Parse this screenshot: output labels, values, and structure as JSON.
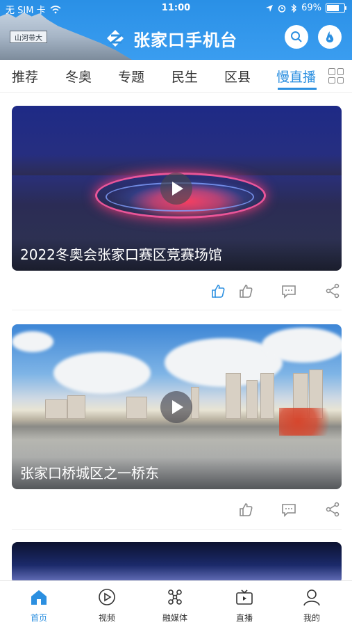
{
  "status_bar": {
    "carrier": "无 SIM 卡",
    "time": "11:00",
    "battery": "69%"
  },
  "header": {
    "app_title": "张家口手机台",
    "plaque_text": "山河带大",
    "icons": {
      "search": "search-icon",
      "profile": "live-broadcast-icon"
    },
    "colors": {
      "brand_blue": "#2b8fe0",
      "header_bg": "#3a9df0"
    }
  },
  "tabs": {
    "items": [
      {
        "label": "推荐"
      },
      {
        "label": "冬奥"
      },
      {
        "label": "专题"
      },
      {
        "label": "民生"
      },
      {
        "label": "区县"
      },
      {
        "label": "慢直播"
      }
    ],
    "active_index": 5,
    "grid_icon": "grid-icon"
  },
  "feed": {
    "items": [
      {
        "title": "2022冬奥会张家口赛区竞赛场馆",
        "actions": {
          "like_active": true
        }
      },
      {
        "title": "张家口桥城区之一桥东",
        "actions": {
          "like_active": false
        }
      }
    ]
  },
  "bottom_nav": {
    "items": [
      {
        "label": "首页",
        "icon": "home-icon"
      },
      {
        "label": "视频",
        "icon": "play-circle-icon"
      },
      {
        "label": "融媒体",
        "icon": "media-icon"
      },
      {
        "label": "直播",
        "icon": "tv-icon"
      },
      {
        "label": "我的",
        "icon": "user-icon"
      }
    ],
    "active_index": 0
  }
}
